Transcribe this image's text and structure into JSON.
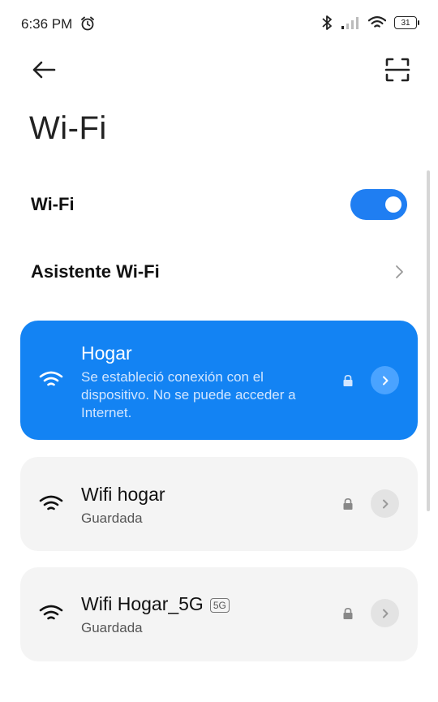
{
  "status_bar": {
    "time": "6:36 PM",
    "battery": "31",
    "icons": [
      "alarm-icon",
      "bluetooth-icon",
      "signal-icon",
      "wifi-icon",
      "battery-icon"
    ]
  },
  "page": {
    "title": "Wi-Fi"
  },
  "settings": {
    "wifi_label": "Wi-Fi",
    "wifi_enabled": true,
    "assistant_label": "Asistente Wi-Fi"
  },
  "networks": [
    {
      "name": "Hogar",
      "status": "Se estableció conexión con el dispositivo. No se puede acceder a Internet.",
      "connected": true,
      "secured": true
    },
    {
      "name": "Wifi hogar",
      "status": "Guardada",
      "connected": false,
      "secured": true
    },
    {
      "name": "Wifi Hogar_5G",
      "badge": "5G",
      "status": "Guardada",
      "connected": false,
      "secured": true
    }
  ],
  "colors": {
    "accent": "#1383f3",
    "toggle_on": "#1f7ef2",
    "card_bg": "#f4f4f4"
  }
}
